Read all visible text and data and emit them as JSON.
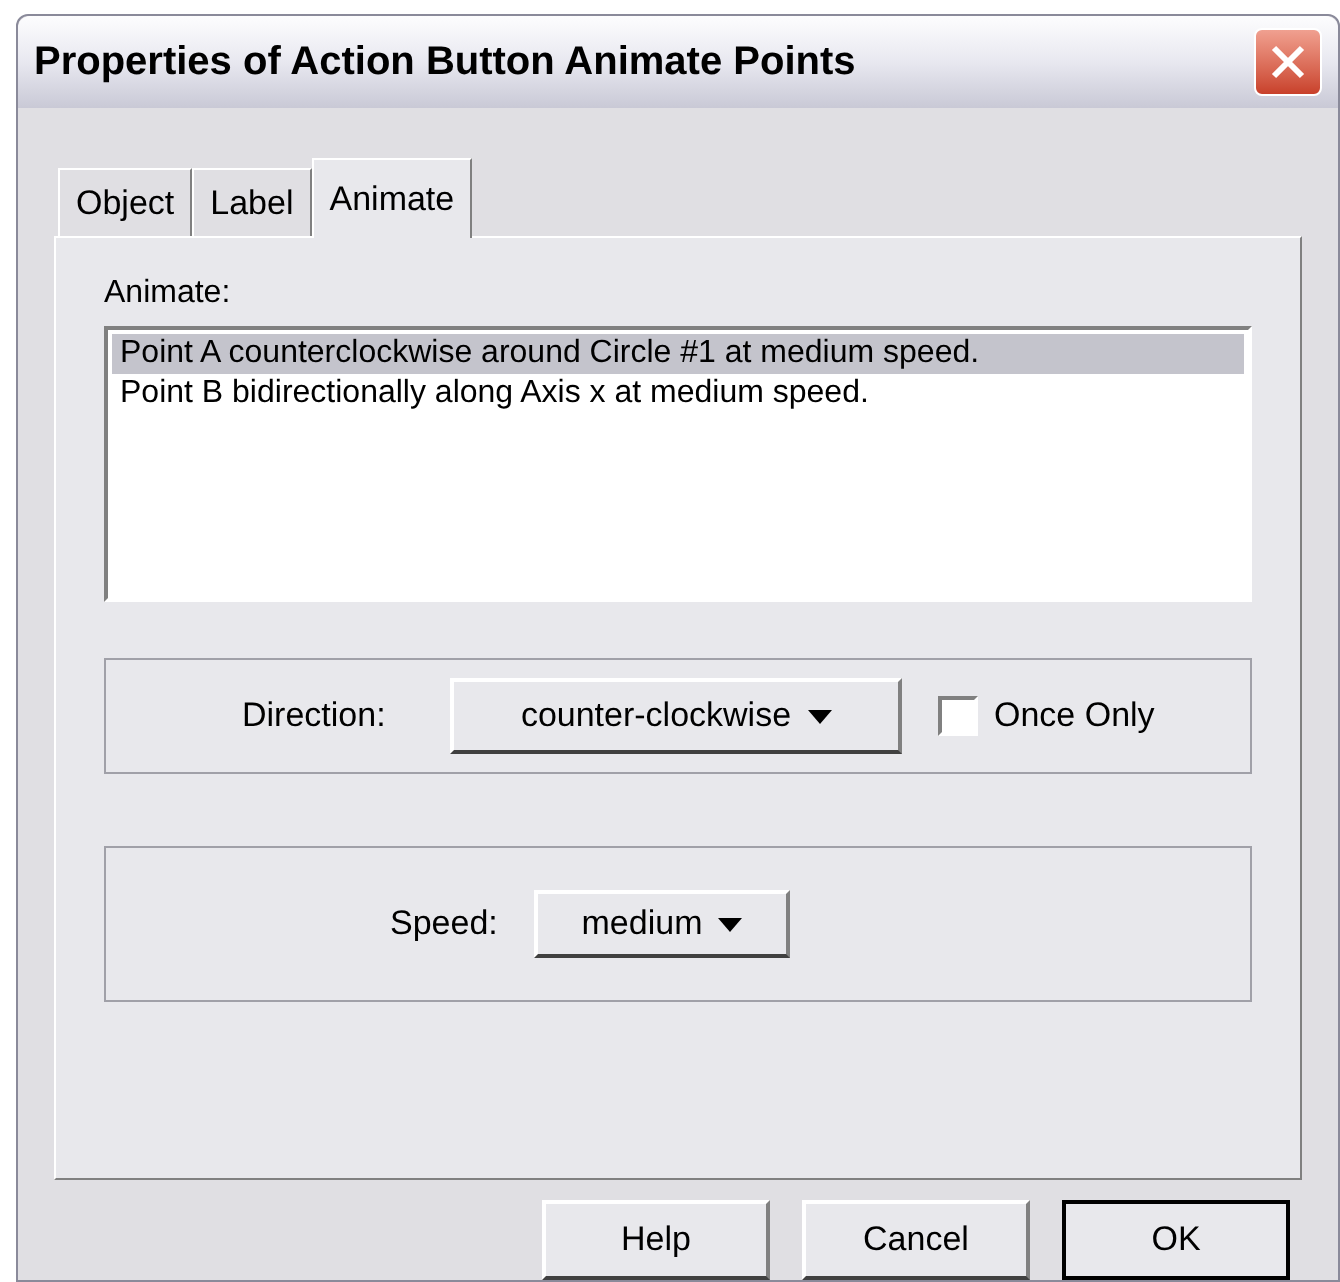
{
  "window": {
    "title": "Properties of Action Button Animate Points"
  },
  "tabs": [
    {
      "label": "Object",
      "selected": false
    },
    {
      "label": "Label",
      "selected": false
    },
    {
      "label": "Animate",
      "selected": true
    }
  ],
  "animate": {
    "label": "Animate:",
    "items": [
      {
        "text": "Point A counterclockwise around Circle #1 at medium speed.",
        "selected": true
      },
      {
        "text": "Point B bidirectionally along Axis x at medium speed.",
        "selected": false
      }
    ]
  },
  "direction": {
    "label": "Direction:",
    "value": "counter-clockwise",
    "once_only": {
      "label": "Once Only",
      "checked": false
    }
  },
  "speed": {
    "label": "Speed:",
    "value": "medium"
  },
  "buttons": [
    {
      "label": "Help",
      "default": false
    },
    {
      "label": "Cancel",
      "default": false
    },
    {
      "label": "OK",
      "default": true
    }
  ]
}
